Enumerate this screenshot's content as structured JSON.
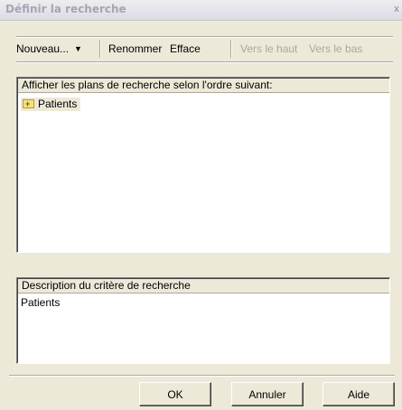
{
  "window": {
    "title": "Définir la recherche",
    "close_glyph": "x"
  },
  "toolbar": {
    "new_label": "Nouveau...",
    "new_dropdown_glyph": "▼",
    "rename_label": "Renommer",
    "delete_label": "Efface",
    "move_up_label": "Vers le haut",
    "move_down_label": "Vers le bas"
  },
  "plans_panel": {
    "header": "Afficher les plans de recherche selon l'ordre suivant:",
    "items": [
      {
        "label": "Patients",
        "icon": "folder-icon"
      }
    ]
  },
  "description_panel": {
    "header": "Description du critère de recherche",
    "text": "Patients"
  },
  "buttons": {
    "ok": "OK",
    "cancel": "Annuler",
    "help": "Aide"
  }
}
